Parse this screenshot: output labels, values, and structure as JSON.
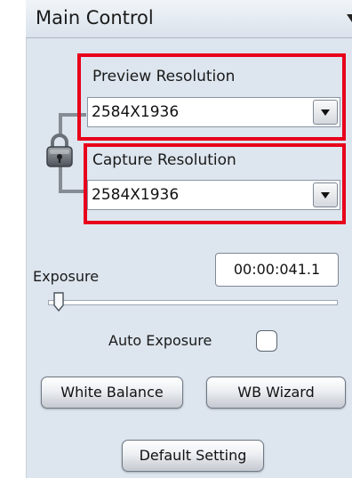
{
  "panel": {
    "title": "Main Control",
    "collapse_icon": "chevron-down-icon"
  },
  "preview": {
    "label": "Preview Resolution",
    "value": "2584X1936"
  },
  "capture": {
    "label": "Capture Resolution",
    "value": "2584X1936"
  },
  "lock_icon": "padlock-icon",
  "exposure": {
    "label": "Exposure",
    "time": "00:00:041.1",
    "slider_fraction": 0.02,
    "auto_label": "Auto Exposure",
    "auto_checked": false
  },
  "buttons": {
    "white_balance": "White Balance",
    "wb_wizard": "WB Wizard",
    "default_setting": "Default Setting"
  },
  "colors": {
    "highlight": "#e8001c",
    "panel_bg": "#dde5ee"
  }
}
